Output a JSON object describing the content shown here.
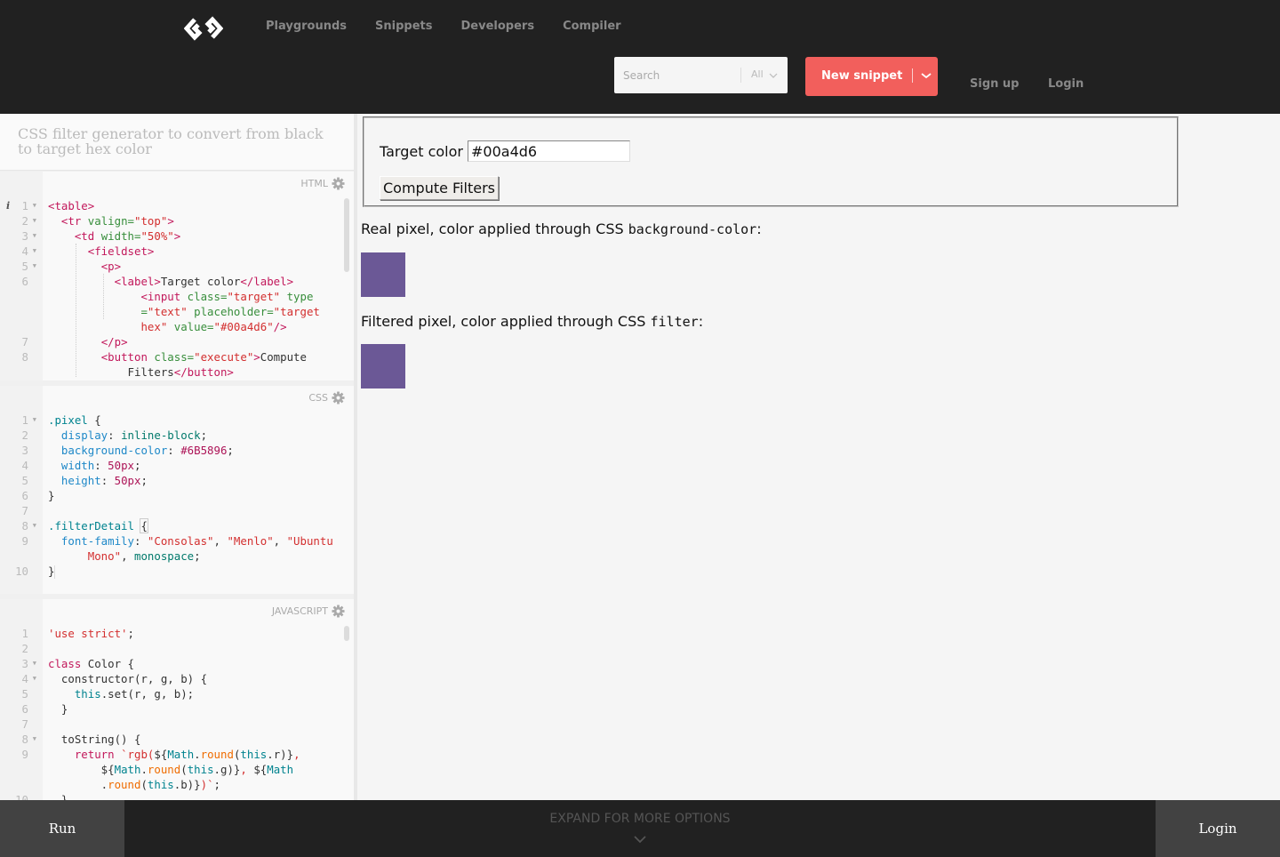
{
  "header": {
    "logo_icon": "codepen-style-link-icon",
    "nav": [
      "Playgrounds",
      "Snippets",
      "Developers",
      "Compiler"
    ],
    "search": {
      "placeholder": "Search",
      "filter": "All"
    },
    "new_snippet_label": "New snippet",
    "sign_up": "Sign up",
    "login": "Login"
  },
  "sidebar": {
    "description": "CSS filter generator to convert from black to target hex color",
    "editors": {
      "html": {
        "label": "HTML"
      },
      "css": {
        "label": "CSS"
      },
      "js": {
        "label": "JAVASCRIPT"
      }
    }
  },
  "preview": {
    "target_label": "Target color",
    "target_value": "#00a4d6",
    "compute_button": "Compute Filters",
    "real_text": "Real pixel, color applied through CSS ",
    "real_code": "background-color",
    "real_suffix": ":",
    "filtered_text": "Filtered pixel, color applied through CSS ",
    "filtered_code": "filter",
    "filtered_suffix": ":",
    "pixel_color": "#6B5896"
  },
  "footer": {
    "run": "Run",
    "expand": "EXPAND FOR MORE OPTIONS",
    "login": "Login"
  },
  "colors": {
    "accent": "#f25f5c",
    "header_bg": "#212121"
  }
}
